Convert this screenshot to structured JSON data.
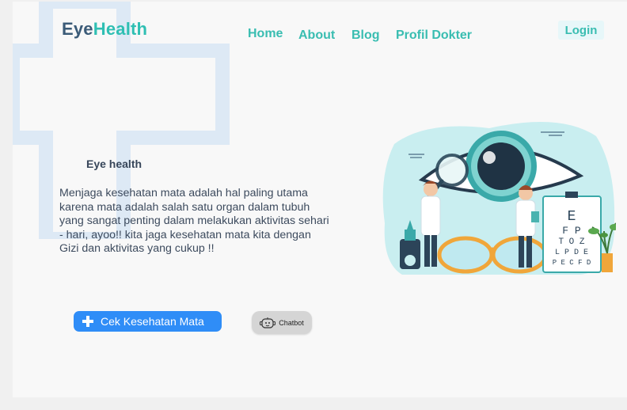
{
  "brand": {
    "part1": "Eye",
    "part2": "Health",
    "color_dark": "#3b5b78",
    "color_accent": "#2fbfb3"
  },
  "nav": {
    "items": [
      {
        "label": "Home"
      },
      {
        "label": "About"
      },
      {
        "label": "Blog"
      },
      {
        "label": "Profil Dokter"
      }
    ],
    "login_label": "Login"
  },
  "hero": {
    "title": "Eye health",
    "description": "Menjaga kesehatan mata adalah hal paling utama karena mata adalah salah satu organ dalam tubuh yang sangat penting dalam melakukan aktivitas sehari - hari, ayoo!! kita jaga kesehatan mata kita dengan Gizi dan aktivitas yang cukup !!"
  },
  "actions": {
    "check_label": "Cek Kesehatan Mata",
    "chatbot_label": "Chatbot",
    "check_color": "#2f8df7",
    "check_icon": "plus-icon",
    "chatbot_icon": "robot-icon"
  },
  "illustration": {
    "eye_chart_rows": [
      "E",
      "F P",
      "T O Z",
      "L P D E",
      "P E C F D"
    ],
    "icons": [
      "eye-icon",
      "magnifier-icon",
      "glasses-icon",
      "plant-icon",
      "eye-drop-icon"
    ]
  }
}
